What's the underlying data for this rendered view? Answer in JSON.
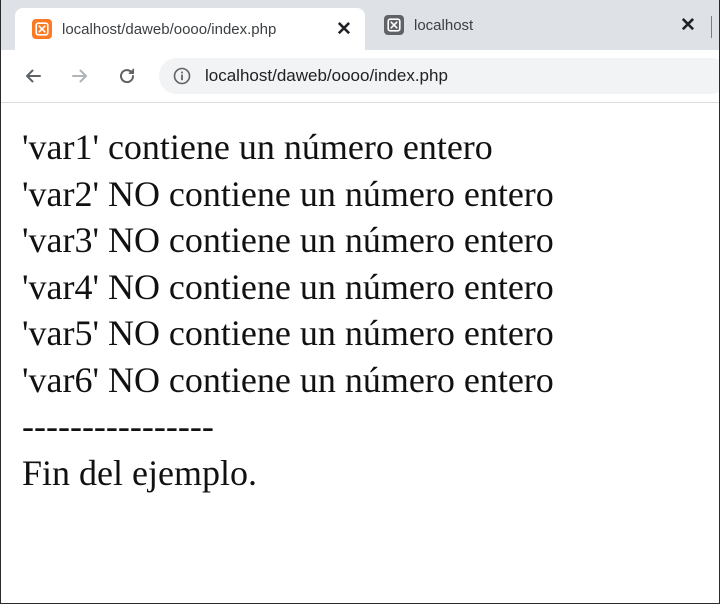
{
  "tabs": [
    {
      "title": "localhost/daweb/oooo/index.php",
      "favicon": "xampp-icon",
      "active": true
    },
    {
      "title": "localhost",
      "favicon": "generic-page-icon",
      "active": false
    }
  ],
  "tab_close_symbol": "✕",
  "toolbar": {
    "back_icon": "back-arrow-icon",
    "forward_icon": "forward-arrow-icon",
    "reload_icon": "reload-icon",
    "site_info_icon": "info-icon",
    "url": "localhost/daweb/oooo/index.php"
  },
  "colors": {
    "tabstrip": "#dee1e6",
    "favicon_active": "#fb7a24",
    "omnibox": "#f1f3f4",
    "text": "#111111"
  },
  "page": {
    "lines": [
      "'var1' contiene un número entero",
      "'var2' NO contiene un número entero",
      "'var3' NO contiene un número entero",
      "'var4' NO contiene un número entero",
      "'var5' NO contiene un número entero",
      "'var6' NO contiene un número entero",
      "----------------",
      "Fin del ejemplo."
    ]
  }
}
